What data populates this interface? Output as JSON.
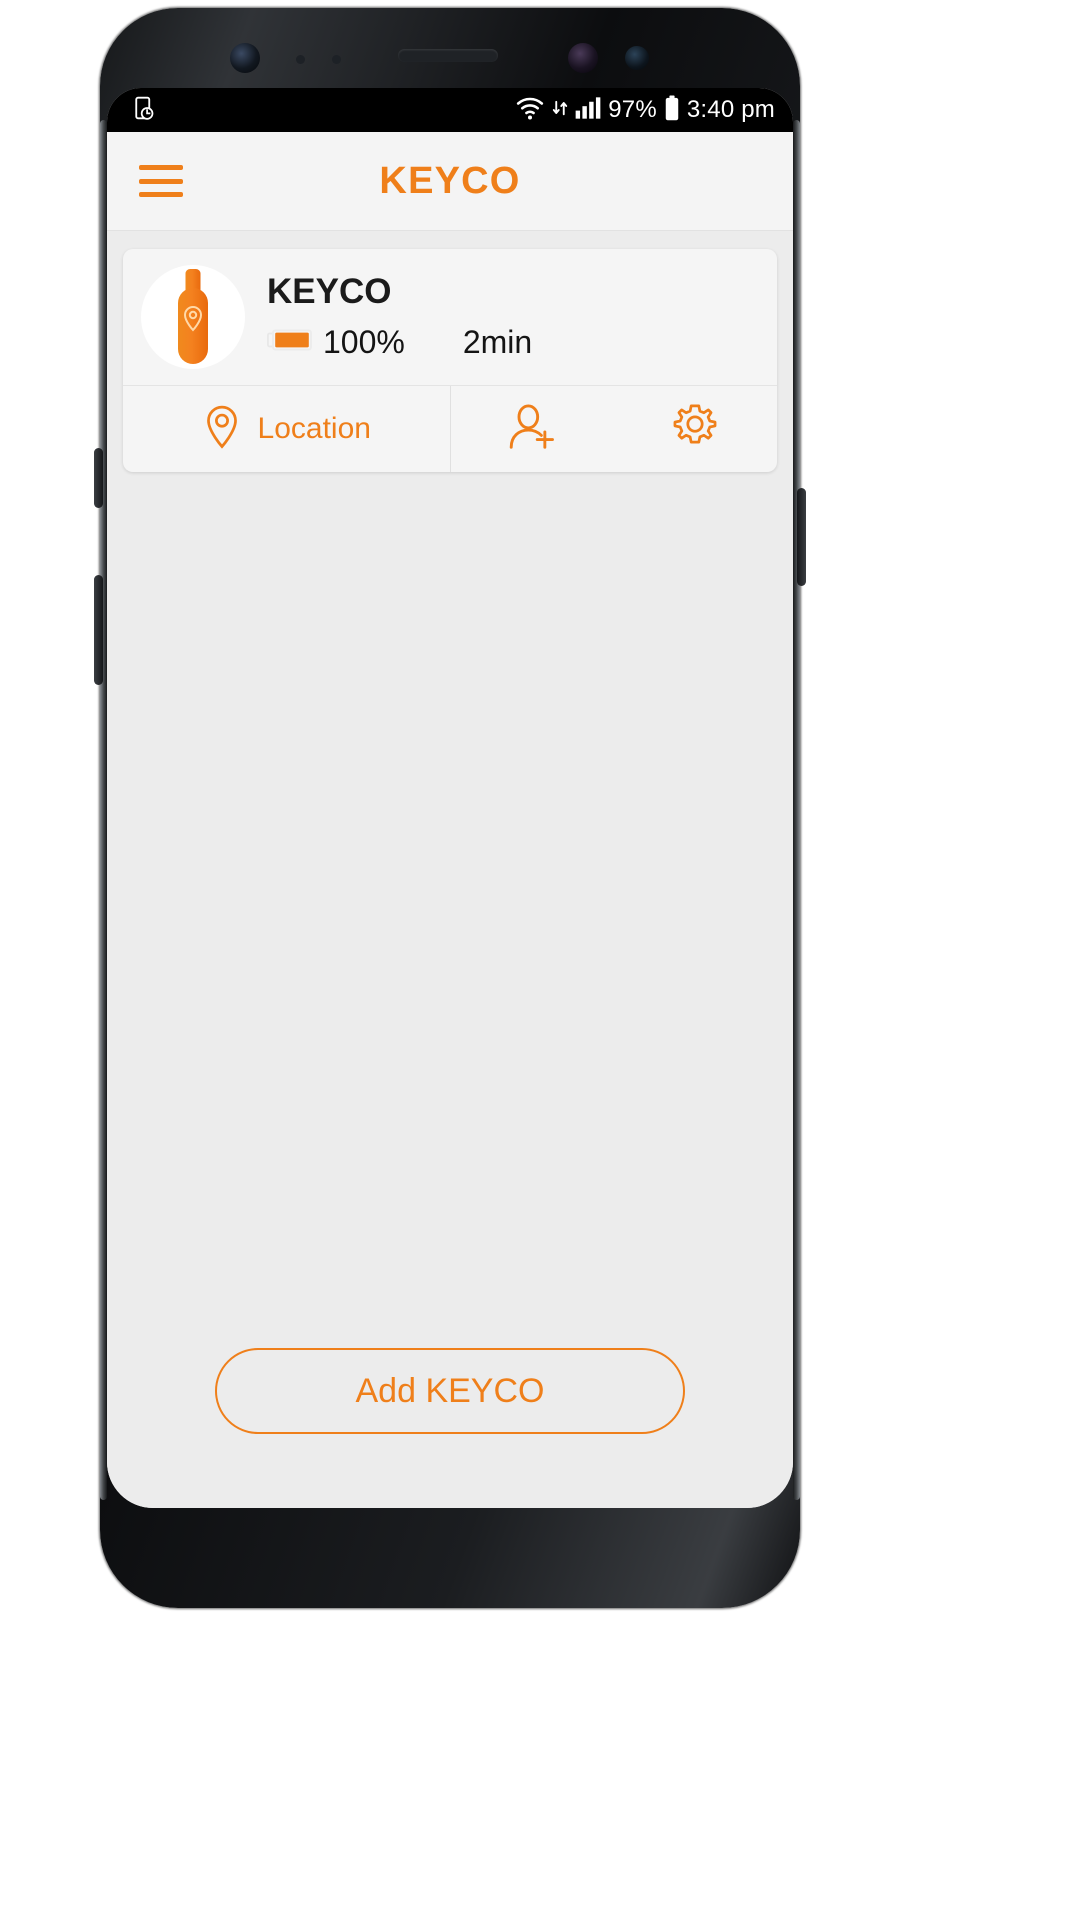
{
  "statusbar": {
    "left_icons": [
      {
        "name": "screen-recorder-icon",
        "glyph": "recorder"
      }
    ],
    "wifi_icon": "wifi-icon",
    "data_arrows_icon": "data-transfer-icon",
    "signal_icon": "cellular-signal-icon",
    "battery_percent": "97%",
    "battery_icon": "battery-icon",
    "time": "3:40 pm"
  },
  "appbar": {
    "menu_icon": "hamburger-menu-icon",
    "title": "KEYCO"
  },
  "device": {
    "avatar_icon": "keyco-tag-icon",
    "name": "KEYCO",
    "battery_icon": "battery-icon",
    "battery_level": "100%",
    "last_seen": "2min",
    "actions": {
      "location_icon": "map-pin-icon",
      "location_label": "Location",
      "share_icon": "add-user-icon",
      "settings_icon": "gear-icon"
    }
  },
  "footer": {
    "add_button_label": "Add KEYCO"
  },
  "colors": {
    "accent": "#ef7f1a",
    "screen_bg": "#ececec",
    "card_bg": "#f5f5f5",
    "appbar_bg": "#f4f4f4",
    "text_dark": "#1b1b1b"
  }
}
